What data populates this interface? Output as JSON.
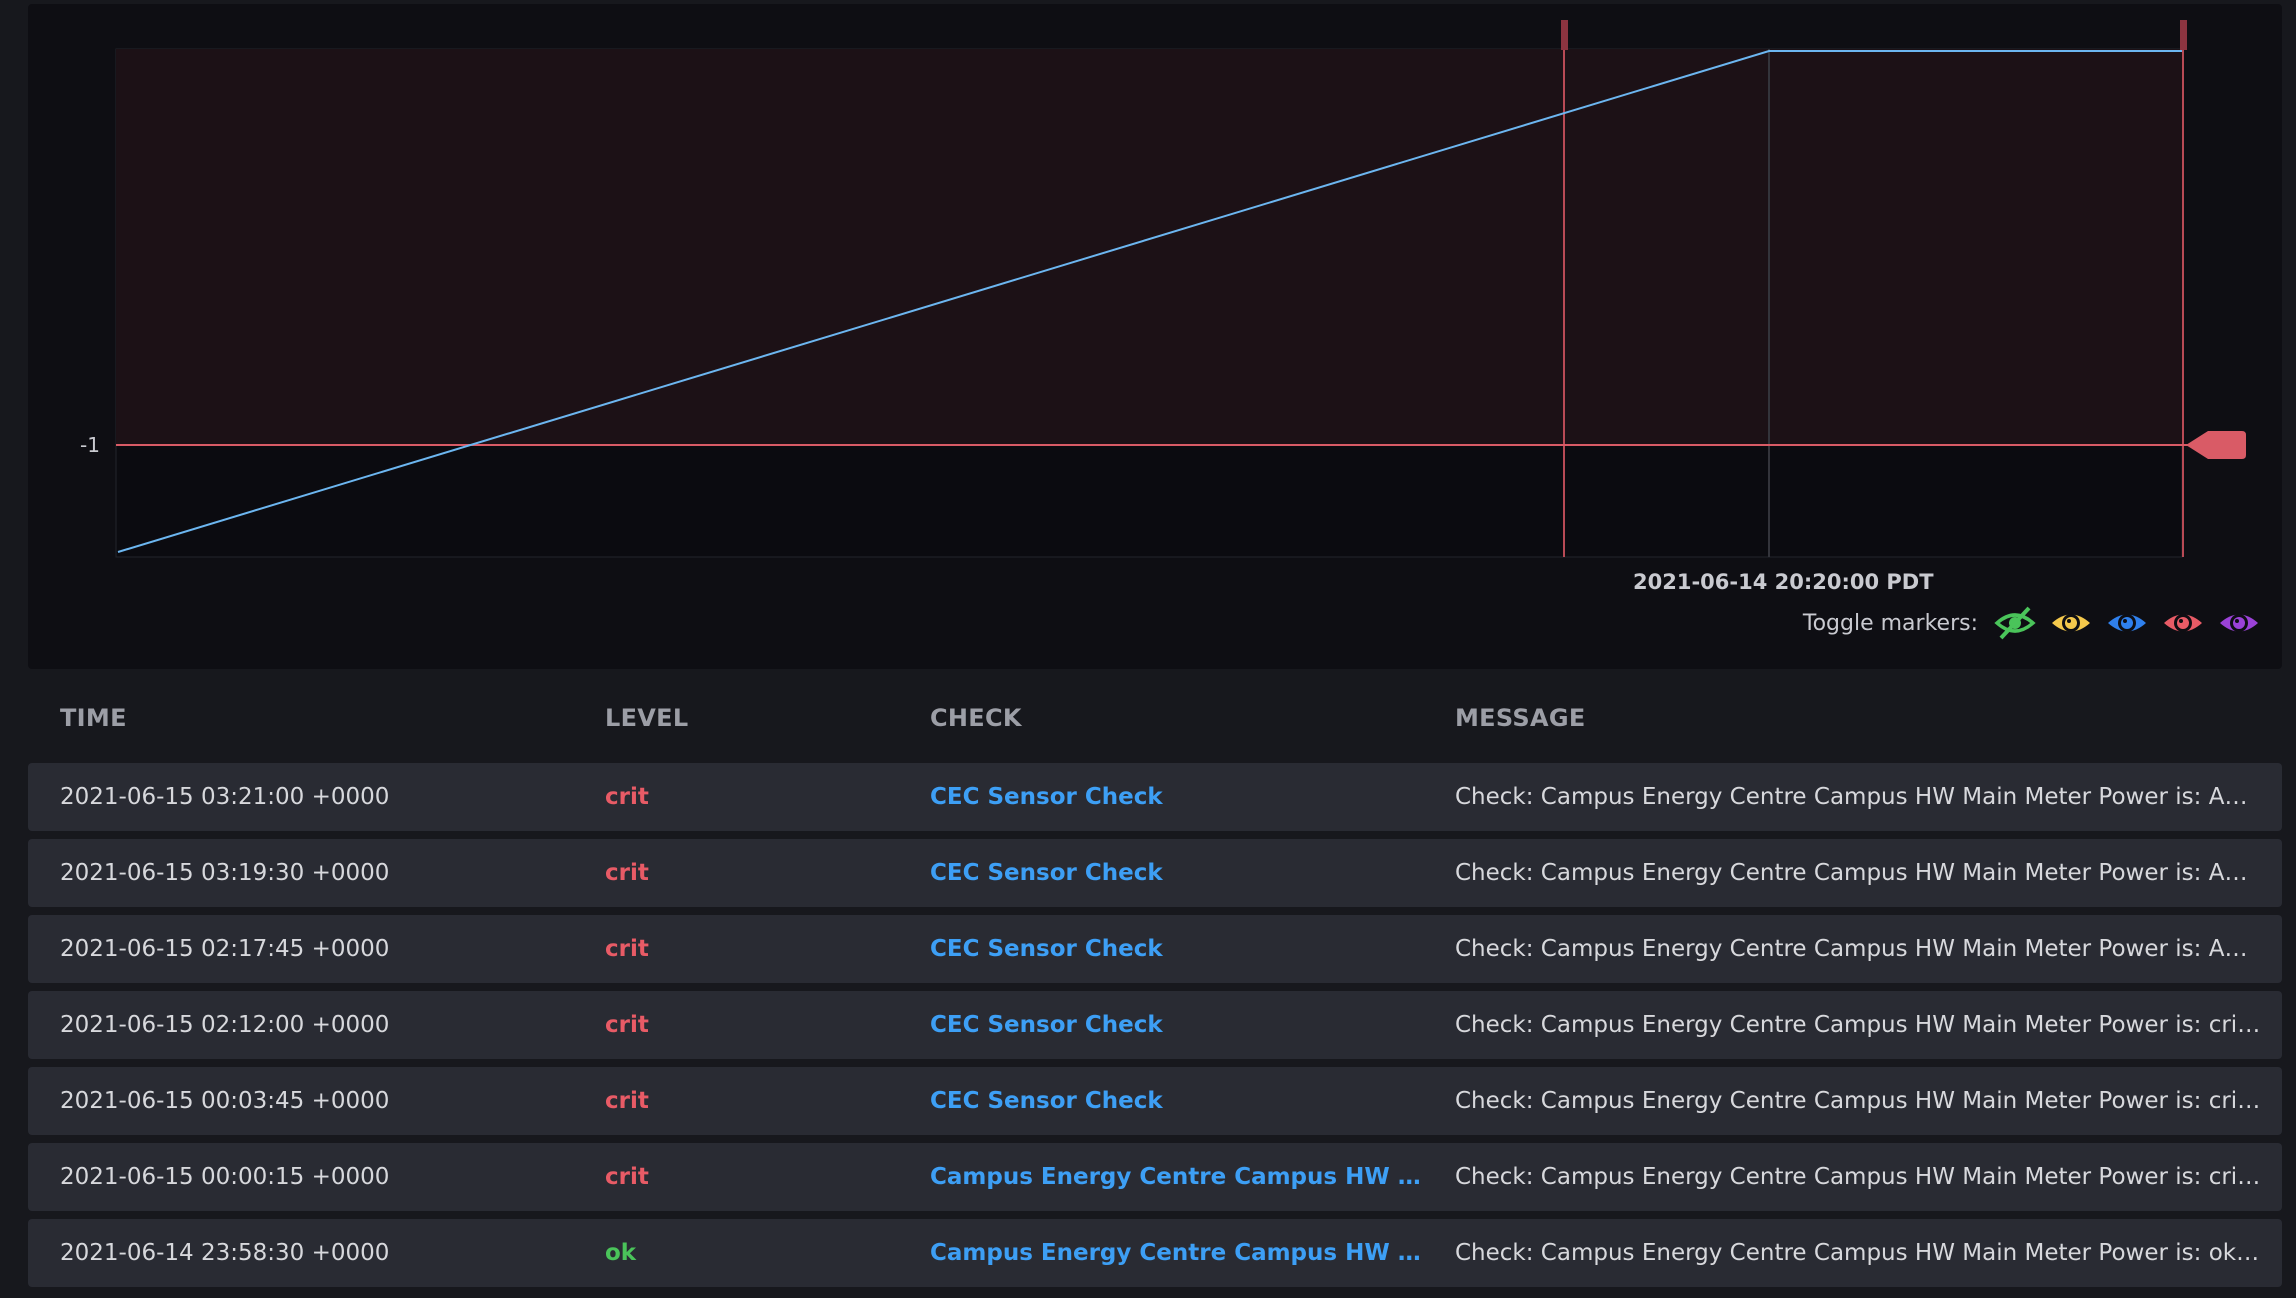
{
  "graph": {
    "y_tick_label": "-1",
    "hover_time": "2021-06-14 20:20:00 PDT",
    "toggle_label": "Toggle markers:",
    "markers": [
      {
        "name": "ok",
        "color": "#4ac45a",
        "hidden": true
      },
      {
        "name": "warn",
        "color": "#f5c94c"
      },
      {
        "name": "info",
        "color": "#2f80ed"
      },
      {
        "name": "crit",
        "color": "#e85b66"
      },
      {
        "name": "unknown",
        "color": "#9b42d8"
      }
    ],
    "colors": {
      "line": "#6cb6f0",
      "threshold": "#d95b66",
      "crit_band": "#1c1116"
    }
  },
  "table": {
    "headers": {
      "time": "TIME",
      "level": "LEVEL",
      "check": "CHECK",
      "message": "MESSAGE"
    },
    "rows": [
      {
        "time": "2021-06-15 03:21:00 +0000",
        "level": "crit",
        "check": "CEC Sensor Check",
        "message": "Check: Campus Energy Centre Campus HW Main Meter Power is: Ano..."
      },
      {
        "time": "2021-06-15 03:19:30 +0000",
        "level": "crit",
        "check": "CEC Sensor Check",
        "message": "Check: Campus Energy Centre Campus HW Main Meter Power is: Ano..."
      },
      {
        "time": "2021-06-15 02:17:45 +0000",
        "level": "crit",
        "check": "CEC Sensor Check",
        "message": "Check: Campus Energy Centre Campus HW Main Meter Power is: Ano..."
      },
      {
        "time": "2021-06-15 02:12:00 +0000",
        "level": "crit",
        "check": "CEC Sensor Check",
        "message": "Check: Campus Energy Centre Campus HW Main Meter Power is: crit, ..."
      },
      {
        "time": "2021-06-15 00:03:45 +0000",
        "level": "crit",
        "check": "CEC Sensor Check",
        "message": "Check: Campus Energy Centre Campus HW Main Meter Power is: crit, ..."
      },
      {
        "time": "2021-06-15 00:00:15 +0000",
        "level": "crit",
        "check": "Campus Energy Centre Campus HW Mai...",
        "message": "Check: Campus Energy Centre Campus HW Main Meter Power is: crit, ..."
      },
      {
        "time": "2021-06-14 23:58:30 +0000",
        "level": "ok",
        "check": "Campus Energy Centre Campus HW Mai...",
        "message": "Check: Campus Energy Centre Campus HW Main Meter Power is: ok, A..."
      }
    ]
  }
}
